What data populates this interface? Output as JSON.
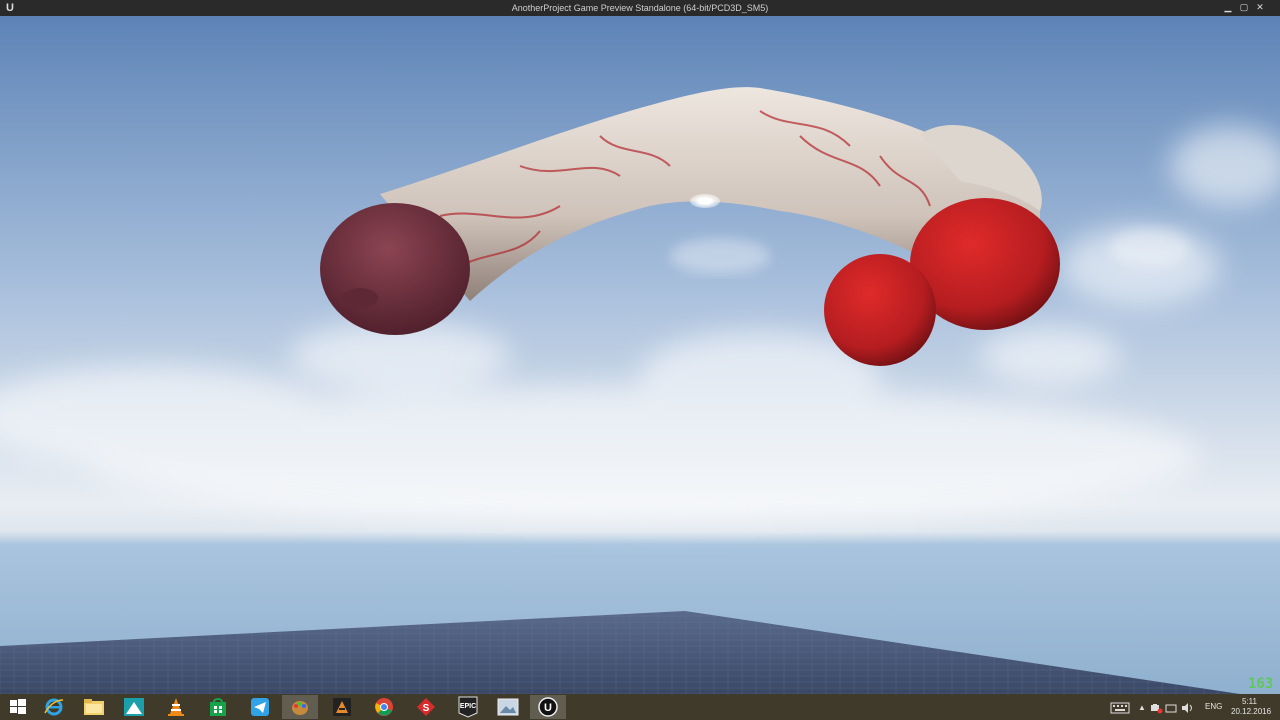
{
  "window": {
    "title": "AnotherProject Game Preview Standalone (64-bit/PCD3D_SM5)",
    "app_logo_glyph": "U",
    "minimize_glyph": "▁",
    "maximize_glyph": "▢",
    "close_glyph": "✕"
  },
  "scene": {
    "sky_colors": [
      "#5d83b6",
      "#a8bfdc",
      "#e8edf3"
    ],
    "floor_color": "#3f4d6e",
    "model_primary_color": "#d9cfc6",
    "model_accent_color": "#b01a1e"
  },
  "hud": {
    "fps_text": "163"
  },
  "taskbar": {
    "background": "#3f3a2a",
    "items": [
      {
        "name": "windows-start",
        "icon": "windows-logo-icon"
      },
      {
        "name": "internet-explorer",
        "icon": "internet-explorer-icon"
      },
      {
        "name": "file-explorer",
        "icon": "folder-icon"
      },
      {
        "name": "app-teal",
        "icon": "mountain-app-icon"
      },
      {
        "name": "vlc",
        "icon": "vlc-cone-icon"
      },
      {
        "name": "store",
        "icon": "store-bag-icon"
      },
      {
        "name": "telegram",
        "icon": "telegram-icon"
      },
      {
        "name": "app-paint",
        "icon": "paint-palette-icon"
      },
      {
        "name": "app-game",
        "icon": "game-app-icon"
      },
      {
        "name": "chrome",
        "icon": "chrome-icon"
      },
      {
        "name": "app-red",
        "icon": "red-app-icon"
      },
      {
        "name": "epic-games",
        "icon": "epic-games-icon"
      },
      {
        "name": "app-image",
        "icon": "image-viewer-icon"
      },
      {
        "name": "unreal-engine",
        "icon": "unreal-engine-icon"
      }
    ],
    "tray": {
      "language": "ENG",
      "time": "5:11",
      "date": "20.12.2016"
    }
  }
}
